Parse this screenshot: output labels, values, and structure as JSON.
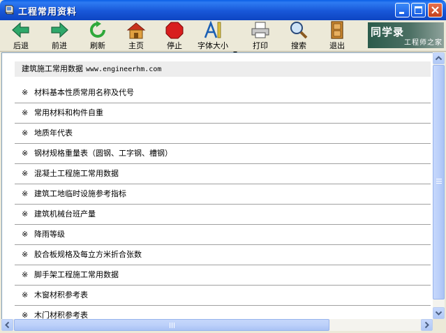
{
  "window": {
    "title": "工程常用资料"
  },
  "toolbar": {
    "back": "后退",
    "forward": "前进",
    "refresh": "刷新",
    "home": "主页",
    "stop": "停止",
    "font_size": "字体大小",
    "print": "打印",
    "search": "搜索",
    "exit": "退出"
  },
  "logo": {
    "main": "同学录",
    "sub": "工程师之家"
  },
  "content": {
    "header_title": "建筑施工常用数据",
    "header_url": "www.engineerhm.com",
    "bullet": "※",
    "items": [
      "材料基本性质常用名称及代号",
      "常用材料和构件自重",
      "地质年代表",
      "钢材规格重量表（圆钢、工字钢、槽钢）",
      "混凝土工程施工常用数据",
      "建筑工地临时设施参考指标",
      "建筑机械台班产量",
      "降雨等级",
      "胶合板规格及每立方米折合张数",
      "脚手架工程施工常用数据",
      "木窗材积参考表",
      "木门材积参考表"
    ]
  },
  "colors": {
    "titlebar": "#0D45C2",
    "toolbar_bg": "#ECE9D8",
    "header_row_bg": "#EDEDED",
    "scroll_thumb": "#BCD0FA"
  }
}
